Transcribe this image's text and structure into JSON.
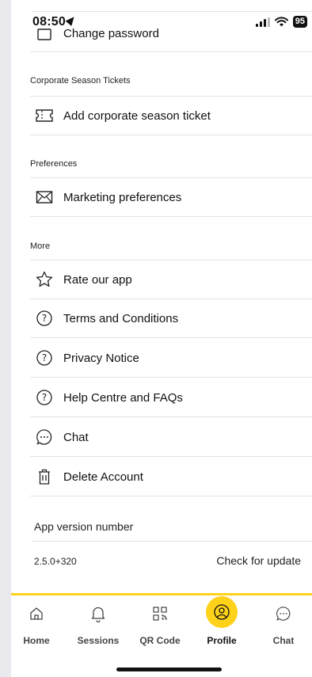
{
  "status_bar": {
    "time": "08:50",
    "battery": "95"
  },
  "settings": {
    "change_password": "Change password",
    "sections": {
      "corporate": "Corporate Season Tickets",
      "preferences": "Preferences",
      "more": "More"
    },
    "items": {
      "add_corporate": "Add corporate season ticket",
      "marketing": "Marketing preferences",
      "rate": "Rate our app",
      "terms": "Terms and Conditions",
      "privacy": "Privacy Notice",
      "help": "Help Centre and FAQs",
      "chat": "Chat",
      "delete": "Delete Account"
    },
    "app_version_label": "App version number",
    "version": "2.5.0+320",
    "check_update": "Check for update"
  },
  "nav": {
    "home": "Home",
    "sessions": "Sessions",
    "qr": "QR Code",
    "profile": "Profile",
    "chat": "Chat",
    "active": "Profile"
  },
  "colors": {
    "accent": "#ffd21a"
  }
}
